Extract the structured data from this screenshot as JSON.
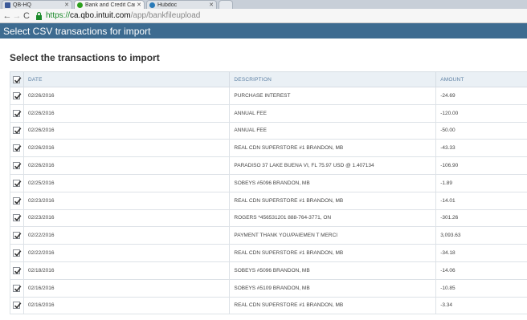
{
  "browser": {
    "tabs": [
      {
        "label": "QB-HQ",
        "color": "#3b5998",
        "active": false
      },
      {
        "label": "Bank and Credit Cards",
        "color": "#2ca01c",
        "active": true
      },
      {
        "label": "Hubdoc",
        "color": "#2a7ab8",
        "active": false
      }
    ],
    "url": {
      "scheme": "https://",
      "host": "ca.qbo.intuit.com",
      "path": "/app/bankfileupload"
    }
  },
  "page": {
    "header": "Select CSV transactions for import",
    "section_title": "Select the transactions to import"
  },
  "table": {
    "columns": {
      "date": "DATE",
      "description": "DESCRIPTION",
      "amount": "AMOUNT"
    },
    "rows": [
      {
        "date": "02/26/2016",
        "description": "PURCHASE INTEREST",
        "amount": "-24.69"
      },
      {
        "date": "02/26/2016",
        "description": "ANNUAL FEE",
        "amount": "-120.00"
      },
      {
        "date": "02/26/2016",
        "description": "ANNUAL FEE",
        "amount": "-50.00"
      },
      {
        "date": "02/26/2016",
        "description": "REAL CDN SUPERSTORE #1 BRANDON, MB",
        "amount": "-43.33"
      },
      {
        "date": "02/26/2016",
        "description": "PARADISO 37 LAKE BUENA VI, FL 75.97 USD @ 1.407134",
        "amount": "-106.90"
      },
      {
        "date": "02/25/2016",
        "description": "SOBEYS #5096 BRANDON, MB",
        "amount": "-1.89"
      },
      {
        "date": "02/23/2016",
        "description": "REAL CDN SUPERSTORE #1 BRANDON, MB",
        "amount": "-14.01"
      },
      {
        "date": "02/23/2016",
        "description": "ROGERS *456531201 888-764-3771, ON",
        "amount": "-301.26"
      },
      {
        "date": "02/22/2016",
        "description": "PAYMENT THANK YOU/PAIEMEN T MERCI",
        "amount": "3,093.63"
      },
      {
        "date": "02/22/2016",
        "description": "REAL CDN SUPERSTORE #1 BRANDON, MB",
        "amount": "-34.18"
      },
      {
        "date": "02/18/2016",
        "description": "SOBEYS #5096 BRANDON, MB",
        "amount": "-14.06"
      },
      {
        "date": "02/16/2016",
        "description": "SOBEYS #5109 BRANDON, MB",
        "amount": "-10.85"
      },
      {
        "date": "02/16/2016",
        "description": "REAL CDN SUPERSTORE #1 BRANDON, MB",
        "amount": "-3.34"
      }
    ]
  }
}
